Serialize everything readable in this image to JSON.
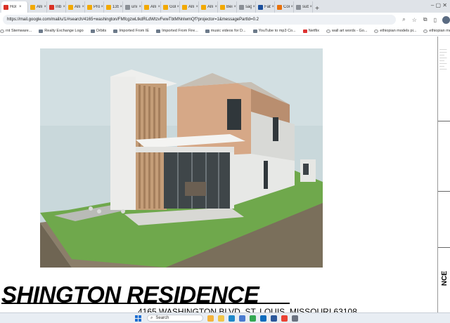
{
  "browser": {
    "tabs": [
      {
        "label": "Hol",
        "favicon_color": "#d93025",
        "active": true
      },
      {
        "label": "Alli",
        "favicon_color": "#f2a900"
      },
      {
        "label": "Inb",
        "favicon_color": "#d93025"
      },
      {
        "label": "Alli",
        "favicon_color": "#f2a900"
      },
      {
        "label": "Pro",
        "favicon_color": "#f2a900"
      },
      {
        "label": "135",
        "favicon_color": "#f2a900"
      },
      {
        "label": "uni",
        "favicon_color": "#8a8f96"
      },
      {
        "label": "Alli",
        "favicon_color": "#f2a900"
      },
      {
        "label": "Gol",
        "favicon_color": "#f2a900"
      },
      {
        "label": "Alli",
        "favicon_color": "#f2a900"
      },
      {
        "label": "Alli",
        "favicon_color": "#f2a900"
      },
      {
        "label": "Bei",
        "favicon_color": "#f2a900"
      },
      {
        "label": "sag",
        "favicon_color": "#8a8f96"
      },
      {
        "label": "Fab",
        "favicon_color": "#1b4f9c"
      },
      {
        "label": "Cor",
        "favicon_color": "#e8710a"
      },
      {
        "label": "sub",
        "favicon_color": "#8a8f96"
      }
    ],
    "new_tab_symbol": "+",
    "window_controls": "–  ▢  ✕",
    "url": "https://mail.google.com/mail/u/1/#search/4165+washington/FMfcgzwLtkdRLdWtzvFwwTbtMNnlwmQf?projector=1&messagePartId=0.2",
    "toolbar_icons": [
      "zoom-icon",
      "star-icon",
      "extensions-icon",
      "sidebar-icon"
    ],
    "bookmarks": [
      {
        "label": "rnt Stemware...",
        "kind": "g"
      },
      {
        "label": "Realty Exchange Logo",
        "kind": "folder"
      },
      {
        "label": "Orbits",
        "kind": "folder"
      },
      {
        "label": "Imported From IE",
        "kind": "folder"
      },
      {
        "label": "Imported From Fire...",
        "kind": "folder"
      },
      {
        "label": "music videos for D...",
        "kind": "folder"
      },
      {
        "label": "YouTube to mp3 Co...",
        "kind": "folder"
      },
      {
        "label": "Netflix",
        "kind": "red"
      },
      {
        "label": "wall art words - Go...",
        "kind": "g"
      },
      {
        "label": "ethiopian models pi...",
        "kind": "g"
      },
      {
        "label": "ethiopian models pi...",
        "kind": "g"
      }
    ]
  },
  "document": {
    "title": "SHINGTON RESIDENCE",
    "address": "4165 WASHINGTON BLVD, ST. LOUIS, MISSOURI 63108",
    "right_edge_label": "NCE",
    "render_colors": {
      "sky": "#c9d8db",
      "grass": "#6fa84c",
      "wood": "#c9a27e",
      "wall": "#e7e8e6",
      "slab": "#8b7e6a"
    }
  },
  "taskbar": {
    "search_placeholder": "Search",
    "apps": [
      {
        "name": "widgets",
        "color": "#f3b33d"
      },
      {
        "name": "file-explorer",
        "color": "#f0c54a"
      },
      {
        "name": "edge",
        "color": "#1e88c9"
      },
      {
        "name": "store",
        "color": "#4a7bd0"
      },
      {
        "name": "chrome",
        "color": "#34a853"
      },
      {
        "name": "outlook",
        "color": "#0f6cbd"
      },
      {
        "name": "word",
        "color": "#2b579a"
      },
      {
        "name": "chrome-2",
        "color": "#ea4335"
      },
      {
        "name": "settings",
        "color": "#6b7280"
      }
    ]
  }
}
